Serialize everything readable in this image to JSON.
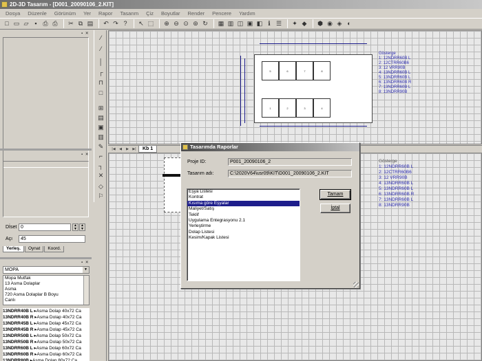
{
  "app": {
    "title": "2D-3D Tasarım - [D001_20090106_2.KIT]"
  },
  "menu": [
    "Dosya",
    "Düzenle",
    "Görünüm",
    "Yer",
    "Rapor",
    "Tasarım",
    "Çiz",
    "Boyutlar",
    "Render",
    "Pencere",
    "Yardım"
  ],
  "toolbar": {
    "icons": [
      "new-icon",
      "open-icon",
      "folder-icon",
      "save-icon",
      "print-icon",
      "print-preview-icon",
      "cut-icon",
      "copy-icon",
      "paste-icon",
      "undo-icon",
      "redo-icon",
      "help-icon",
      "pointer-icon",
      "select-icon",
      "zoom-in-icon",
      "zoom-out-icon",
      "zoom-window-icon",
      "zoom-all-icon",
      "refresh-icon",
      "layer-icon",
      "grid-icon",
      "panel-icon",
      "snap-icon",
      "view-icon",
      "info-icon",
      "list-icon",
      "bulb-icon",
      "cube-icon",
      "solid-icon",
      "shade-icon",
      "render-icon",
      "camera-icon"
    ],
    "glyphs": [
      "□",
      "▭",
      "▱",
      "▪",
      "⎙",
      "⎙",
      "✂",
      "⧉",
      "▤",
      "↶",
      "↷",
      "?",
      "↖",
      "⬚",
      "⊕",
      "⊖",
      "⊙",
      "⊚",
      "↻",
      "▦",
      "▥",
      "◫",
      "▣",
      "◧",
      "ℹ",
      "☰",
      "✦",
      "◆",
      "⬢",
      "◉",
      "◈",
      "◐"
    ]
  },
  "left_panel": {
    "field_dist_label": "Dİset",
    "field_dist_value": "0",
    "field_angle_label": "Açı",
    "field_angle_value": "45",
    "tabs": [
      "Yerleş.",
      "Oynat",
      "Koord."
    ],
    "category": "MOPA",
    "product_groups": [
      "Mopa Mutfak",
      "13 Asma Dolaplar",
      "Asma",
      "720  Asma Dolaplar B Boyu",
      "Canlı"
    ],
    "catalog": [
      {
        "code": "13NDRR40B L",
        "desc": "Asma Dolap 40x72 Ca"
      },
      {
        "code": "13NDRR40B R",
        "desc": "Asma Dolap 40x72 Ca"
      },
      {
        "code": "13NDRR45B L",
        "desc": "Asma Dolap 45x72 Ca"
      },
      {
        "code": "13NDRR45B R",
        "desc": "Asma Dolap 45x72 Ca"
      },
      {
        "code": "13NDRR50B L",
        "desc": "Asma Dolap 50x72 Ca"
      },
      {
        "code": "13NDRR50B R",
        "desc": "Asma Dolap 50x72 Ca"
      },
      {
        "code": "13NDRR60B L",
        "desc": "Asma Dolap 60x72 Ca"
      },
      {
        "code": "13NDRR60B R",
        "desc": "Asma Dolap 60x72 Ca"
      },
      {
        "code": "13NDRR80B",
        "desc": "Asma Dolap 80x72 Ca"
      }
    ]
  },
  "drawing": {
    "sheet_tab": "Kb 1",
    "legend_title": "Gösterge",
    "legend_items": [
      "1:  12NDRR60B L",
      "2:  12CTRR60B6",
      "3:  12 VRR90B",
      "4:  13NDRR60B L",
      "5:  13NDRR60B L",
      "6:  13NDRR60B R",
      "7:  13NDRR60B L",
      "8:  13NDRR90B"
    ],
    "top_cells": [
      "5",
      "6",
      "7",
      "8"
    ],
    "bottom_cells": [
      "1",
      "2",
      "3",
      "4"
    ]
  },
  "dialog": {
    "title": "Tasarımda Raporlar",
    "project_id_label": "Proje ID:",
    "project_id_value": "P001_20090106_2",
    "design_name_label": "Tasarım adı:",
    "design_name_value": "C:\\2020V64\\usr09\\KIT\\D001_20090106_2.KIT",
    "reports": [
      "Eşya Listesi",
      "Kontrat",
      "Kısıma göre Eşyalar",
      "Maliyet/Satış",
      "Teklif",
      "Uygulama Entegrasyonu 2.1",
      "Yerleştirme",
      "Dolap Listesi",
      "Kesim/Kapak Listesi"
    ],
    "selected_index": 2,
    "ok_label": "Tamam",
    "cancel_label": "İptal"
  },
  "colors": {
    "selection": "#1e1e8c",
    "dimension": "#1a1a8a",
    "legend": "#2a2ab0"
  }
}
